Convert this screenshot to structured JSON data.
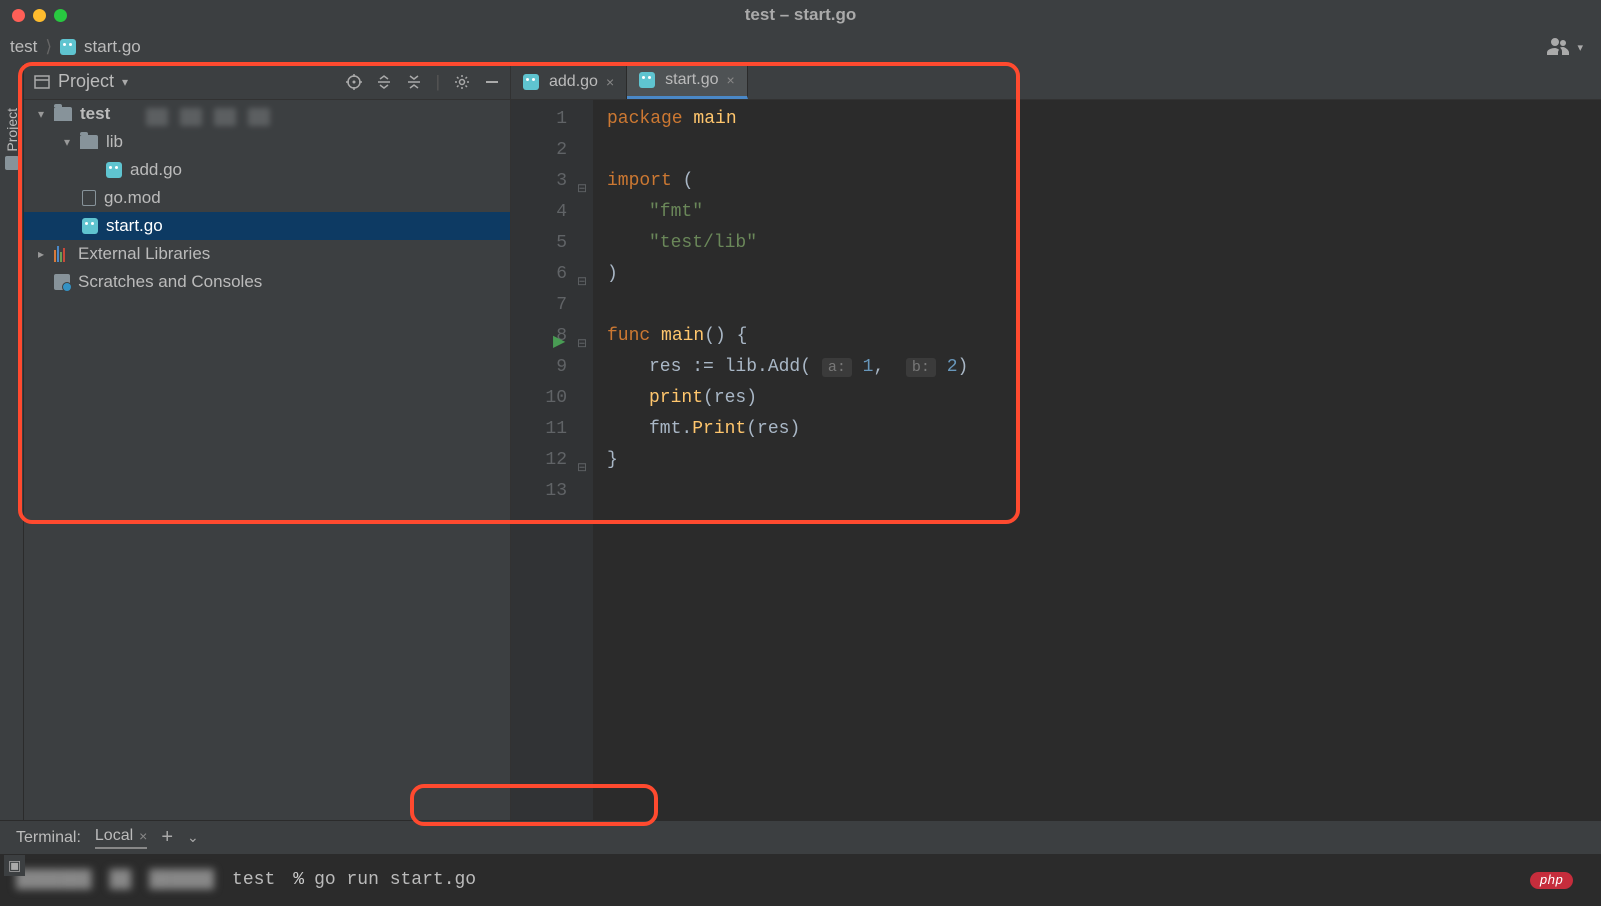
{
  "window": {
    "title": "test – start.go"
  },
  "breadcrumbs": {
    "root": "test",
    "file": "start.go"
  },
  "projectPanel": {
    "title": "Project",
    "sidebarLabel": "Project"
  },
  "tree": {
    "root": "test",
    "lib": "lib",
    "addgo": "add.go",
    "gomod": "go.mod",
    "startgo": "start.go",
    "external": "External Libraries",
    "scratches": "Scratches and Consoles"
  },
  "tabs": {
    "addgo": "add.go",
    "startgo": "start.go"
  },
  "code": {
    "lines": {
      "1": "1",
      "2": "2",
      "3": "3",
      "4": "4",
      "5": "5",
      "6": "6",
      "7": "7",
      "8": "8",
      "9": "9",
      "10": "10",
      "11": "11",
      "12": "12",
      "13": "13"
    },
    "package_kw": "package ",
    "package_name": "main",
    "import_kw": "import ",
    "import_open": "(",
    "fmt": "\"fmt\"",
    "testlib": "\"test/lib\"",
    "import_close": ")",
    "func_kw": "func ",
    "main_name": "main",
    "main_sig": "() {",
    "res_assign": "res := ",
    "libadd": "lib.Add(",
    "param_a": "a:",
    "val_a": " 1",
    "comma": ",",
    "param_b": "b:",
    "val_b": " 2",
    "close_paren": ")",
    "print_call": "print",
    "print_arg": "(res)",
    "fmtprint": "fmt.",
    "fmtprint_fn": "Print",
    "fmtprint_arg": "(res)",
    "closebrace": "}"
  },
  "terminal": {
    "title": "Terminal:",
    "tab": "Local",
    "prompt_dir": "test",
    "prompt_sep": "%",
    "command": "go run start.go"
  },
  "badges": {
    "php": "php"
  }
}
